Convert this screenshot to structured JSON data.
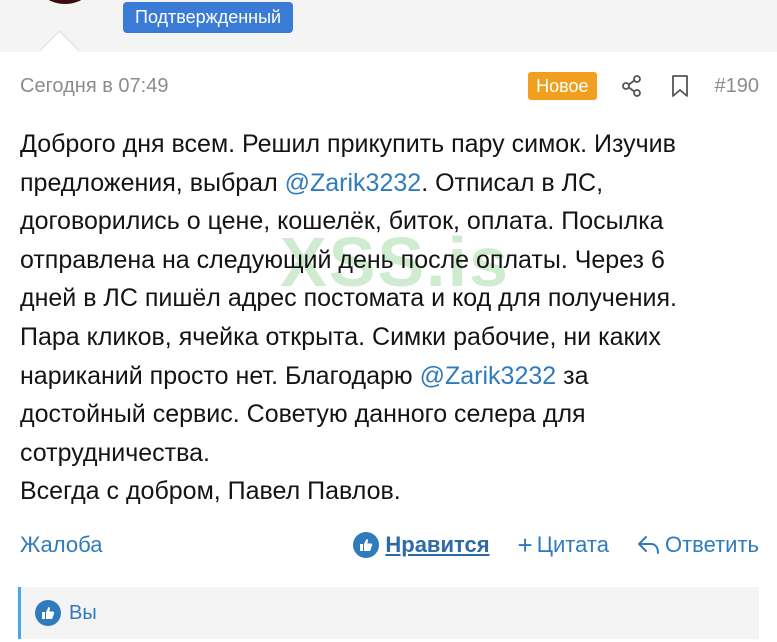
{
  "user": {
    "badge": "Подтвержденный"
  },
  "post": {
    "date": "Сегодня в 07:49",
    "new_label": "Новое",
    "number": "#190",
    "watermark": "XSS.is",
    "lines": [
      [
        "Доброго дня всем. Решил прикупить пару симок. Изучив",
        "",
        ""
      ],
      [
        "предложения, выбрал ",
        "@Zarik3232",
        ". Отписал в ЛС,"
      ],
      [
        "договорились о цене, кошелёк, биток, оплата. Посылка",
        "",
        ""
      ],
      [
        "отправлена на следующий день после оплаты. Через 6",
        "",
        ""
      ],
      [
        "дней в ЛС пишёл адрес постомата и код для получения.",
        "",
        ""
      ],
      [
        "Пара кликов, ячейка открыта. Симки рабочие, ни каких",
        "",
        ""
      ],
      [
        "нариканий просто нет. Благодарю ",
        "@Zarik3232",
        " за"
      ],
      [
        "достойный сервис. Советую данного селера для",
        "",
        ""
      ],
      [
        "сотрудничества.",
        "",
        ""
      ],
      [
        "Всегда с добром, Павел Павлов.",
        "",
        ""
      ]
    ]
  },
  "actions": {
    "report": "Жалоба",
    "like": "Нравится",
    "quote": "Цитата",
    "reply": "Ответить"
  },
  "likes": {
    "you": "Вы"
  },
  "colors": {
    "link": "#2f7bbd",
    "badge_blue": "#3a7bd5",
    "new_orange": "#f0a01e",
    "accent_bar": "#47a7eb"
  },
  "icons": [
    "share-icon",
    "bookmark-icon",
    "like-icon",
    "plus-icon",
    "reply-icon"
  ]
}
